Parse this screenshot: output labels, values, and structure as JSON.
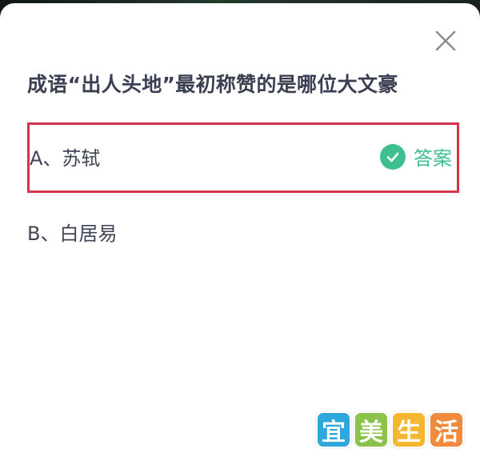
{
  "question": {
    "text": "成语“出人头地”最初称赞的是哪位大文豪"
  },
  "options": [
    {
      "label": "A、苏轼",
      "is_answer": true
    },
    {
      "label": "B、白居易",
      "is_answer": false
    }
  ],
  "answer_tag": {
    "text": "答案",
    "icon": "check-circle-icon",
    "color": "#3fbf8f"
  },
  "highlight_color": "#d4334a",
  "close": {
    "icon": "close-icon"
  },
  "watermark": {
    "chars": [
      "宜",
      "美",
      "生",
      "活"
    ],
    "colors": [
      "#2fa7dd",
      "#8bc34a",
      "#f5b630",
      "#f08a3c"
    ]
  }
}
